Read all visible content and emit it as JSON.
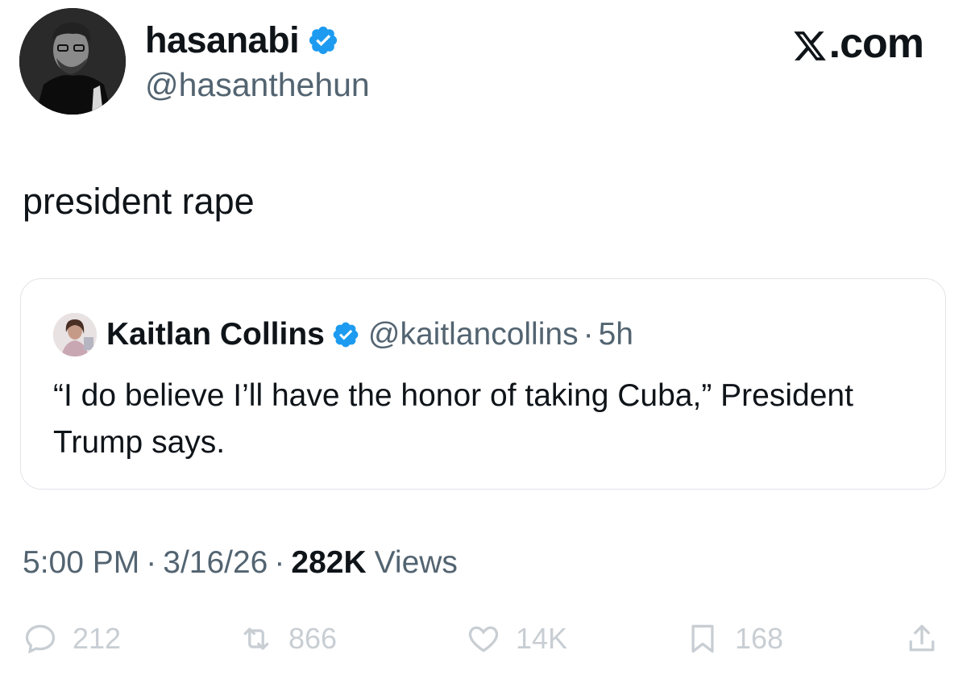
{
  "author": {
    "display_name": "hasanabi",
    "handle": "@hasanthehun",
    "verified_icon": "verified-badge-icon",
    "avatar_icon": "user-avatar"
  },
  "brand": {
    "label": ".com",
    "logo_icon": "x-logo-icon"
  },
  "tweet": {
    "text": "president rape"
  },
  "quoted": {
    "display_name": "Kaitlan Collins",
    "handle": "@kaitlancollins",
    "separator": "·",
    "time": "5h",
    "text": "“I do believe I’ll have the honor of taking Cuba,” President Trump says."
  },
  "meta": {
    "time": "5:00 PM",
    "sep1": "·",
    "date": "3/16/26",
    "sep2": "·",
    "views_count": "282K",
    "views_label": "Views"
  },
  "actions": {
    "replies": "212",
    "reposts": "866",
    "likes": "14K",
    "bookmarks": "168"
  },
  "colors": {
    "text": "#0f1419",
    "secondary": "#536471",
    "verified": "#1d9bf0",
    "action_icons": "#c8ced3",
    "border": "#e1e4e8"
  }
}
